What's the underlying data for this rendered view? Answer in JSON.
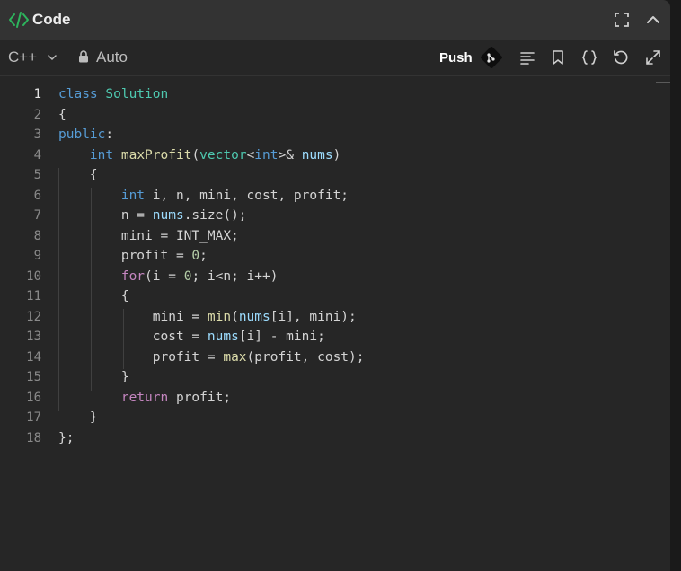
{
  "header": {
    "title": "Code",
    "icon": "code-brackets-icon",
    "accent_color": "#2db55d",
    "buttons": [
      "fullscreen-icon",
      "collapse-chevron-up-icon"
    ]
  },
  "toolbar": {
    "language": "C++",
    "mode": "Auto",
    "push_label": "Push",
    "icons": [
      "git-icon",
      "format-lines-icon",
      "bookmark-icon",
      "braces-icon",
      "reset-icon",
      "expand-icon"
    ]
  },
  "editor": {
    "active_line": 1,
    "line_numbers": [
      "1",
      "2",
      "3",
      "4",
      "5",
      "6",
      "7",
      "8",
      "9",
      "10",
      "11",
      "12",
      "13",
      "14",
      "15",
      "16",
      "17",
      "18"
    ],
    "lines": [
      "class Solution",
      "{",
      "public:",
      "    int maxProfit(vector<int>& nums)",
      "    {",
      "        int i, n, mini, cost, profit;",
      "        n = nums.size();",
      "        mini = INT_MAX;",
      "        profit = 0;",
      "        for(i = 0; i<n; i++)",
      "        {",
      "            mini = min(nums[i], mini);",
      "            cost = nums[i] - mini;",
      "            profit = max(profit, cost);",
      "        }",
      "        return profit;",
      "    }",
      "};"
    ]
  }
}
